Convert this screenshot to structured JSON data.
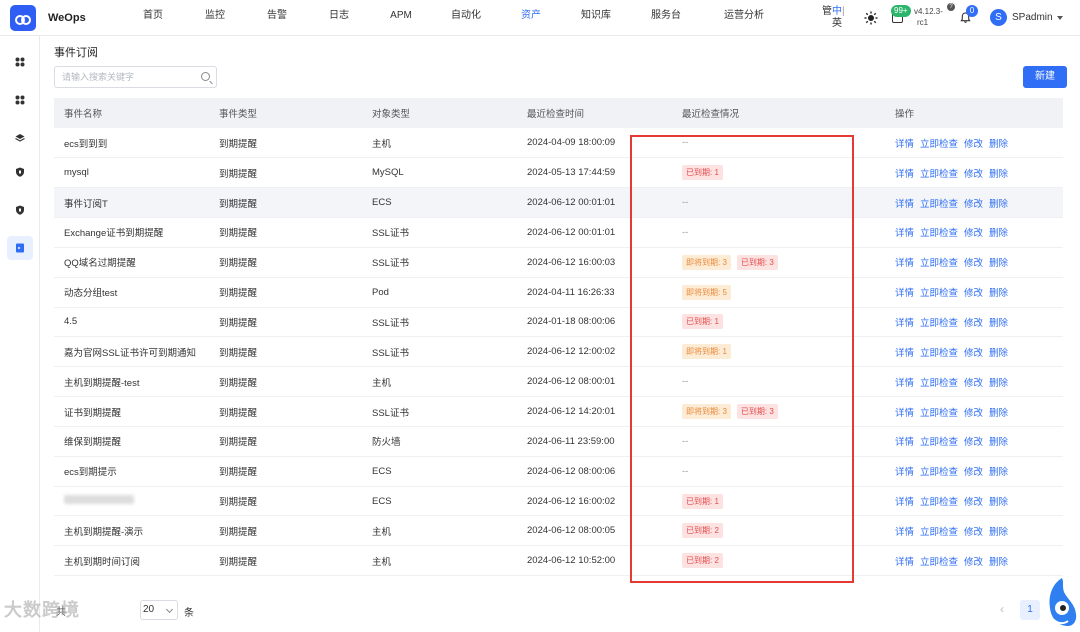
{
  "app": {
    "brand": "WeOps"
  },
  "nav": {
    "items": [
      {
        "label": "首页",
        "w": 62
      },
      {
        "label": "监控",
        "w": 62
      },
      {
        "label": "告警",
        "w": 62
      },
      {
        "label": "日志",
        "w": 62
      },
      {
        "label": "APM",
        "w": 62
      },
      {
        "label": "自动化",
        "w": 68
      },
      {
        "label": "资产",
        "w": 62
      },
      {
        "label": "知识库",
        "w": 68
      },
      {
        "label": "服务台",
        "w": 72
      },
      {
        "label": "运营分析",
        "w": 84
      }
    ],
    "active_index": 6
  },
  "header": {
    "lang_zh": "中",
    "lang_en": "英",
    "lang_prefix": "管",
    "msg_badge": "99+",
    "version_line1": "v4.12.3-",
    "version_line2": "rc1",
    "help": "?",
    "bell_badge": "0",
    "avatar_letter": "S",
    "username": "SPadmin"
  },
  "page": {
    "title": "事件订阅",
    "search_placeholder": "请输入搜索关键字",
    "new_button": "新建"
  },
  "table": {
    "headers": [
      "事件名称",
      "事件类型",
      "对象类型",
      "最近检查时间",
      "最近检查情况",
      "操作"
    ],
    "actions": [
      "详情",
      "立即检查",
      "修改",
      "删除"
    ],
    "rows": [
      {
        "name": "ecs到到到",
        "type": "到期提醒",
        "obj": "主机",
        "time": "2024-04-09 18:00:09",
        "status": []
      },
      {
        "name": "mysql",
        "type": "到期提醒",
        "obj": "MySQL",
        "time": "2024-05-13 17:44:59",
        "status": [
          {
            "text": "已到期: 1",
            "color": "red"
          }
        ]
      },
      {
        "name": "事件订阅T",
        "type": "到期提醒",
        "obj": "ECS",
        "time": "2024-06-12 00:01:01",
        "status": []
      },
      {
        "name": "Exchange证书到期提醒",
        "type": "到期提醒",
        "obj": "SSL证书",
        "time": "2024-06-12 00:01:01",
        "status": []
      },
      {
        "name": "QQ域名过期提醒",
        "type": "到期提醒",
        "obj": "SSL证书",
        "time": "2024-06-12 16:00:03",
        "status": [
          {
            "text": "即将到期: 3",
            "color": "orange"
          },
          {
            "text": "已到期: 3",
            "color": "red"
          }
        ]
      },
      {
        "name": "动态分组test",
        "type": "到期提醒",
        "obj": "Pod",
        "time": "2024-04-11 16:26:33",
        "status": [
          {
            "text": "即将到期: 5",
            "color": "orange"
          }
        ]
      },
      {
        "name": "4.5",
        "type": "到期提醒",
        "obj": "SSL证书",
        "time": "2024-01-18 08:00:06",
        "status": [
          {
            "text": "已到期: 1",
            "color": "red"
          }
        ]
      },
      {
        "name": "嘉为官网SSL证书许可到期通知",
        "type": "到期提醒",
        "obj": "SSL证书",
        "time": "2024-06-12 12:00:02",
        "status": [
          {
            "text": "即将到期: 1",
            "color": "orange"
          }
        ]
      },
      {
        "name": "主机到期提醒-test",
        "type": "到期提醒",
        "obj": "主机",
        "time": "2024-06-12 08:00:01",
        "status": []
      },
      {
        "name": "证书到期提醒",
        "type": "到期提醒",
        "obj": "SSL证书",
        "time": "2024-06-12 14:20:01",
        "status": [
          {
            "text": "即将到期: 3",
            "color": "orange"
          },
          {
            "text": "已到期: 3",
            "color": "red"
          }
        ]
      },
      {
        "name": "维保到期提醒",
        "type": "到期提醒",
        "obj": "防火墙",
        "time": "2024-06-11 23:59:00",
        "status": []
      },
      {
        "name": "ecs到期提示",
        "type": "到期提醒",
        "obj": "ECS",
        "time": "2024-06-12 08:00:06",
        "status": []
      },
      {
        "name": "",
        "type": "到期提醒",
        "obj": "ECS",
        "time": "2024-06-12 16:00:02",
        "status": [
          {
            "text": "已到期: 1",
            "color": "red"
          }
        ],
        "blurred": true
      },
      {
        "name": "主机到期提醒-演示",
        "type": "到期提醒",
        "obj": "主机",
        "time": "2024-06-12 08:00:05",
        "status": [
          {
            "text": "已到期: 2",
            "color": "red"
          }
        ]
      },
      {
        "name": "主机到期时间订阅",
        "type": "到期提醒",
        "obj": "主机",
        "time": "2024-06-12 10:52:00",
        "status": [
          {
            "text": "已到期: 2",
            "color": "red"
          }
        ]
      }
    ],
    "empty_status": "--",
    "hover_row": 2
  },
  "footer": {
    "total_label": "共",
    "page_size": "20",
    "per_label": "条",
    "prev": "‹",
    "current_page": "1"
  },
  "watermark": "大数跨境",
  "colors": {
    "primary": "#2f6ef5",
    "danger": "#e34d4d",
    "warning": "#e8893b",
    "highlight": "#e53935"
  }
}
